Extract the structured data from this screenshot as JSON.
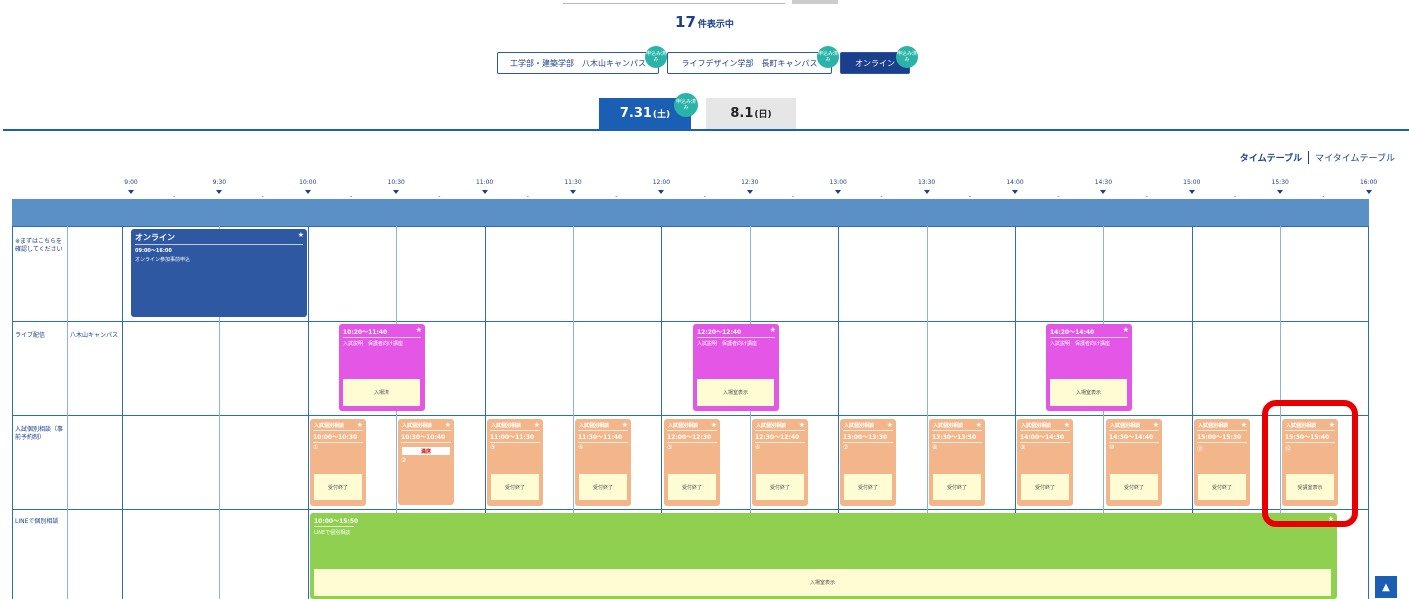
{
  "results": {
    "count": "17",
    "unit": "件表示中"
  },
  "campus_tabs": [
    {
      "label": "工学部・建築学部　八木山キャンパス",
      "badge": "申込み済み",
      "active": false
    },
    {
      "label": "ライフデザイン学部　長町キャンパス",
      "badge": "申込み済み",
      "active": false
    },
    {
      "label": "オンライン",
      "badge": "申込み済み",
      "active": true
    }
  ],
  "date_tabs": [
    {
      "date": "7.31",
      "weekday": "(土)",
      "badge": "申込み済み",
      "active": true
    },
    {
      "date": "8.1",
      "weekday": "(日)",
      "active": false
    }
  ],
  "view_toggle": {
    "timetable": "タイムテーブル",
    "my_timetable": "マイタイムテーブル"
  },
  "time_ticks": [
    "9:00",
    "9:30",
    "10:00",
    "10:30",
    "11:00",
    "11:30",
    "12:00",
    "12:30",
    "13:00",
    "13:30",
    "14:00",
    "14:30",
    "15:00",
    "15:30",
    "16:00"
  ],
  "rows": {
    "r1": {
      "label": "※まずはこちらを確認してください",
      "sub": ""
    },
    "r2": {
      "label": "ライブ配信",
      "sub": "八木山キャンパス"
    },
    "r3": {
      "label": "入試個別相談（事前予約制）",
      "sub": ""
    },
    "r4": {
      "label": "LINEで個別相談",
      "sub": ""
    }
  },
  "online_event": {
    "title": "オンライン",
    "time": "09:00～16:00",
    "desc": "オンライン参加事前申込"
  },
  "live_events": [
    {
      "time": "10:20～11:40",
      "desc": "入試説明　保護者向け講座",
      "button": "入場済"
    },
    {
      "time": "12:20～12:40",
      "desc": "入試説明　保護者向け講座",
      "button": "入場室表示"
    },
    {
      "time": "14:20～14:40",
      "desc": "入試説明　保護者向け講座",
      "button": "入場室表示"
    }
  ],
  "consult_events": [
    {
      "title": "入試個別相談",
      "time": "10:00～10:30",
      "num": "①",
      "button": "受付終了"
    },
    {
      "title": "入試個別相談",
      "time": "10:30～10:40",
      "num": "②",
      "status": "満席"
    },
    {
      "title": "入試個別相談",
      "time": "11:00～11:30",
      "num": "③",
      "button": "受付終了"
    },
    {
      "title": "入試個別相談",
      "time": "11:30～11:40",
      "num": "④",
      "button": "受付終了"
    },
    {
      "title": "入試個別相談",
      "time": "12:00～12:30",
      "num": "⑤",
      "button": "受付終了"
    },
    {
      "title": "入試個別相談",
      "time": "12:30～12:40",
      "num": "⑥",
      "button": "受付終了"
    },
    {
      "title": "入試個別相談",
      "time": "13:00～13:30",
      "num": "⑦",
      "button": "受付終了"
    },
    {
      "title": "入試個別相談",
      "time": "13:30～13:50",
      "num": "⑧",
      "button": "受付終了"
    },
    {
      "title": "入試個別相談",
      "time": "14:00～14:30",
      "num": "⑨",
      "button": "受付終了"
    },
    {
      "title": "入試個別相談",
      "time": "14:30～14:40",
      "num": "⑩",
      "button": "受付終了"
    },
    {
      "title": "入試個別相談",
      "time": "15:00～15:30",
      "num": "⑪",
      "button": "受付終了"
    },
    {
      "title": "入試個別相談",
      "time": "15:30～15:40",
      "num": "⑫",
      "button": "受講室表示"
    }
  ],
  "line_event": {
    "time": "10:00～15:50",
    "desc": "LINEで個別相談",
    "button": "入場室表示"
  },
  "scroll_top": {
    "label": "▲"
  },
  "colors": {
    "primary": "#1b5fb4",
    "live": "#e356e6",
    "consult": "#f2b68a",
    "line": "#8fd050",
    "online": "#2f58a2",
    "highlight": "#e80000"
  }
}
